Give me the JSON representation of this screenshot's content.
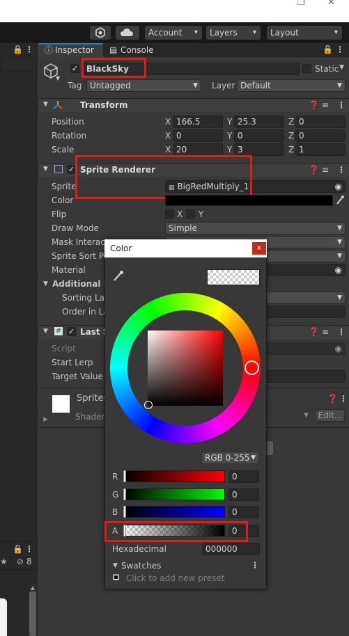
{
  "window": {
    "minimize": "❐",
    "close": "✕"
  },
  "toolbar": {
    "account_label": "Account",
    "layers_label": "Layers",
    "layout_label": "Layout",
    "dropdown_arrow": "▾"
  },
  "tabs": {
    "inspector": "Inspector",
    "console": "Console"
  },
  "object": {
    "name": "BlackSky",
    "static_label": "Static",
    "tag_label": "Tag",
    "tag_value": "Untagged",
    "layer_label": "Layer",
    "layer_value": "Default"
  },
  "transform": {
    "title": "Transform",
    "position_label": "Position",
    "rotation_label": "Rotation",
    "scale_label": "Scale",
    "position": {
      "x": "166.5",
      "y": "25.3",
      "z": "0"
    },
    "rotation": {
      "x": "0",
      "y": "0",
      "z": "0"
    },
    "scale": {
      "x": "20",
      "y": "3",
      "z": "1"
    },
    "axis_x": "X",
    "axis_y": "Y",
    "axis_z": "Z"
  },
  "sprite_renderer": {
    "title": "Sprite Renderer",
    "sprite_label": "Sprite",
    "sprite_value": "BigRedMultiply_1",
    "color_label": "Color",
    "flip_label": "Flip",
    "flip_x": "X",
    "flip_y": "Y",
    "draw_mode_label": "Draw Mode",
    "draw_mode_value": "Simple",
    "mask_label": "Mask Interact",
    "sort_point_label": "Sprite Sort Po",
    "material_label": "Material",
    "additional_label": "Additional Se",
    "sorting_layer_label": "Sorting Lay",
    "order_label": "Order in La"
  },
  "last_script": {
    "title": "Last S",
    "script_label": "Script",
    "start_lerp_label": "Start Lerp",
    "target_value_label": "Target Value"
  },
  "material_section": {
    "name": "Sprites",
    "shader_label": "Shader",
    "edit_label": "Edit..."
  },
  "left_panel": {
    "count": "8"
  },
  "color_picker": {
    "title": "Color",
    "close_label": "x",
    "mode_label": "RGB 0-255",
    "r_label": "R",
    "g_label": "G",
    "b_label": "B",
    "a_label": "A",
    "r_value": "0",
    "g_value": "0",
    "b_value": "0",
    "a_value": "0",
    "hex_label": "Hexadecimal",
    "hex_value": "000000",
    "swatches_label": "Swatches",
    "preset_hint": "Click to add new preset"
  },
  "colors": {
    "highlight": "#e01b1b"
  }
}
